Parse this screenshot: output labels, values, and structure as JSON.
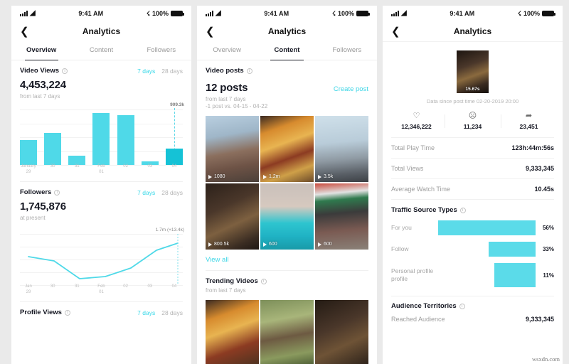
{
  "status_bar": {
    "time": "9:41 AM",
    "battery": "100%"
  },
  "nav": {
    "title": "Analytics",
    "back_icon": "chevron-left-icon"
  },
  "tabs": [
    {
      "label": "Overview"
    },
    {
      "label": "Content"
    },
    {
      "label": "Followers"
    }
  ],
  "overview": {
    "video_views": {
      "title": "Video Views",
      "range_7": "7 days",
      "range_28": "28 days",
      "value": "4,453,224",
      "sub": "from last 7 days",
      "peak_label": "909.3k"
    },
    "followers": {
      "title": "Followers",
      "range_7": "7 days",
      "range_28": "28 days",
      "value": "1,745,876",
      "sub": "at present",
      "peak_label": "1.7m (+13.4k)"
    },
    "profile_views": {
      "title": "Profile Views",
      "range_7": "7 days",
      "range_28": "28 days"
    }
  },
  "content": {
    "video_posts_title": "Video posts",
    "posts_count": "12 posts",
    "create_post": "Create post",
    "sub1": "from last 7 days",
    "sub2": "-1 post vs. 04-15 - 04-22",
    "view_all": "View all",
    "posts": [
      {
        "views": "1080"
      },
      {
        "views": "1.2m"
      },
      {
        "views": "3.5k"
      },
      {
        "views": "800.5k"
      },
      {
        "views": "600"
      },
      {
        "views": "600"
      }
    ],
    "trending": {
      "title": "Trending Videos",
      "sub": "from last 7 days"
    }
  },
  "detail": {
    "duration": "15.67s",
    "caption": "Data since post time 02-20-2019 20:00",
    "stats": [
      {
        "icon": "heart-icon",
        "glyph": "♡",
        "value": "12,346,222"
      },
      {
        "icon": "comment-icon",
        "glyph": "◯",
        "value": "11,234"
      },
      {
        "icon": "share-icon",
        "glyph": "➦",
        "value": "23,451"
      }
    ],
    "metrics": [
      {
        "label": "Total Play Time",
        "value": "123h:44m:56s"
      },
      {
        "label": "Total Views",
        "value": "9,333,345"
      },
      {
        "label": "Average Watch Time",
        "value": "10.45s"
      }
    ],
    "traffic_title": "Traffic Source Types",
    "territories_title": "Audience Territories",
    "reached_label": "Reached Audience",
    "reached_value": "9,333,345"
  },
  "watermark": "wsxdn.com",
  "colors": {
    "accent": "#4fd9e8",
    "accent_dark": "#15c2d6",
    "link": "#3fd6e6",
    "text": "#161823",
    "muted": "#b1b1b1"
  },
  "chart_data": [
    {
      "type": "bar",
      "title": "Video Views",
      "categories": [
        "January 29",
        "30",
        "31",
        "Feb 01",
        "02",
        "03",
        "04"
      ],
      "values": [
        470,
        610,
        175,
        990,
        950,
        70,
        300
      ],
      "ylim": [
        0,
        1050
      ],
      "unit": "k",
      "highlight_index": 6,
      "annotation": "909.3k",
      "grid": true,
      "xlabel": "",
      "ylabel": ""
    },
    {
      "type": "line",
      "title": "Followers",
      "x": [
        "Jan 29",
        "30",
        "31",
        "Feb 01",
        "02",
        "03",
        "04"
      ],
      "values": [
        1.7,
        1.66,
        1.52,
        1.54,
        1.62,
        1.78,
        1.84
      ],
      "ylim": [
        1.45,
        1.9
      ],
      "annotation": "1.7m (+13.4k)",
      "grid": true,
      "xlabel": "",
      "ylabel": ""
    },
    {
      "type": "bar",
      "title": "Traffic Source Types",
      "orientation": "horizontal",
      "categories": [
        "For you",
        "Follow",
        "Personal profile profile"
      ],
      "values": [
        56,
        33,
        11
      ],
      "labels": [
        "56%",
        "33%",
        "11%"
      ],
      "unit": "%",
      "ylim": [
        0,
        100
      ]
    }
  ]
}
